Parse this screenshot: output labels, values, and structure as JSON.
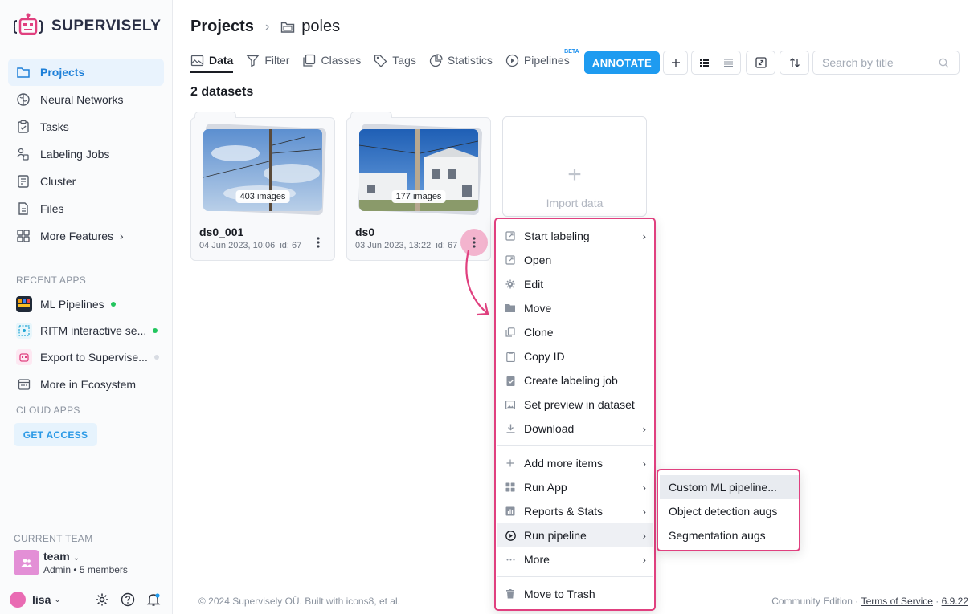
{
  "sidebar": {
    "brand": "SUPERVISELY",
    "nav": [
      {
        "label": "Projects",
        "icon": "folder-icon"
      },
      {
        "label": "Neural Networks",
        "icon": "brain-icon"
      },
      {
        "label": "Tasks",
        "icon": "clipboard-check-icon"
      },
      {
        "label": "Labeling Jobs",
        "icon": "labeling-jobs-icon"
      },
      {
        "label": "Cluster",
        "icon": "cluster-icon"
      },
      {
        "label": "Files",
        "icon": "file-icon"
      },
      {
        "label": "More Features",
        "icon": "grid-icon"
      }
    ],
    "recent_apps_title": "RECENT APPS",
    "recent_apps": [
      {
        "label": "ML Pipelines",
        "status_color": "#22c55e"
      },
      {
        "label": "RITM interactive se...",
        "status_color": "#22c55e"
      },
      {
        "label": "Export to Supervise...",
        "status_color": "#d8dce3"
      }
    ],
    "ecosystem_label": "More in Ecosystem",
    "cloud_apps_title": "CLOUD APPS",
    "get_access_label": "GET ACCESS",
    "current_team_title": "CURRENT TEAM",
    "team_name": "team",
    "team_role": "Admin",
    "team_members": "5 members",
    "user_name": "lisa"
  },
  "breadcrumb": {
    "root": "Projects",
    "current": "poles"
  },
  "tabs": [
    {
      "label": "Data",
      "icon": "image-icon",
      "active": true
    },
    {
      "label": "Filter",
      "icon": "filter-icon"
    },
    {
      "label": "Classes",
      "icon": "classes-icon"
    },
    {
      "label": "Tags",
      "icon": "tag-icon"
    },
    {
      "label": "Statistics",
      "icon": "pie-chart-icon"
    },
    {
      "label": "Pipelines",
      "icon": "play-circle-icon",
      "badge": "BETA"
    }
  ],
  "toolbar": {
    "annotate_label": "ANNOTATE",
    "search_placeholder": "Search by title"
  },
  "datasets_count": "2 datasets",
  "datasets": [
    {
      "name": "ds0_001",
      "images": "403 images",
      "date": "04 Jun 2023, 10:06",
      "id": "id: 67"
    },
    {
      "name": "ds0",
      "images": "177 images",
      "date": "03 Jun 2023, 13:22",
      "id": "id: 67"
    }
  ],
  "import_label": "Import data",
  "context_menu": [
    {
      "label": "Start labeling",
      "icon": "external-link-icon",
      "submenu": true
    },
    {
      "label": "Open",
      "icon": "external-link-icon"
    },
    {
      "label": "Edit",
      "icon": "gear-icon"
    },
    {
      "label": "Move",
      "icon": "folder-icon"
    },
    {
      "label": "Clone",
      "icon": "copy-icon"
    },
    {
      "label": "Copy ID",
      "icon": "clipboard-icon"
    },
    {
      "label": "Create labeling job",
      "icon": "clipboard-check-icon"
    },
    {
      "label": "Set preview in dataset",
      "icon": "image-icon"
    },
    {
      "label": "Download",
      "icon": "download-icon",
      "submenu": true
    },
    {
      "label": "Add more items",
      "icon": "plus-icon",
      "submenu": true
    },
    {
      "label": "Run App",
      "icon": "apps-icon",
      "submenu": true
    },
    {
      "label": "Reports & Stats",
      "icon": "bar-chart-icon",
      "submenu": true
    },
    {
      "label": "Run pipeline",
      "icon": "play-circle-icon",
      "submenu": true,
      "highlighted": true
    },
    {
      "label": "More",
      "icon": "ellipsis-icon",
      "submenu": true
    },
    {
      "label": "Move to Trash",
      "icon": "trash-icon"
    }
  ],
  "pipeline_submenu": [
    {
      "label": "Custom ML pipeline...",
      "highlighted": true
    },
    {
      "label": "Object detection augs"
    },
    {
      "label": "Segmentation augs"
    }
  ],
  "footer": {
    "copyright": "© 2024 Supervisely OÜ. Built with icons8, et al.",
    "edition": "Community Edition",
    "sep": " · ",
    "terms": "Terms of Service",
    "version": "6.9.22"
  },
  "colors": {
    "accent": "#1e9bf0",
    "highlight_border": "#e0407f",
    "brand_logo": "#e0407f"
  }
}
